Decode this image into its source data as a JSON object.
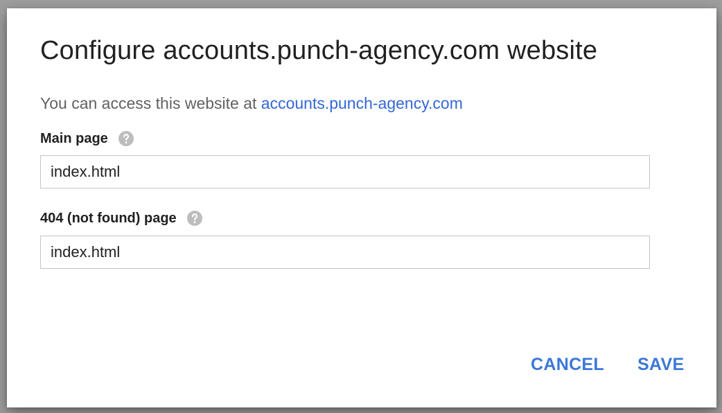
{
  "dialog": {
    "title": "Configure accounts.punch-agency.com website",
    "access_prefix": "You can access this website at ",
    "access_link": "accounts.punch-agency.com",
    "fields": {
      "main_page": {
        "label": "Main page",
        "value": "index.html",
        "help_icon": "help-icon"
      },
      "not_found_page": {
        "label": "404 (not found) page",
        "value": "index.html",
        "help_icon": "help-icon"
      }
    },
    "buttons": {
      "cancel": "CANCEL",
      "save": "SAVE"
    }
  },
  "colors": {
    "accent": "#3b78d8",
    "link": "#3367d6",
    "title_text": "#212121",
    "secondary_text": "#616161",
    "backdrop": "#9e9e9e",
    "input_border": "#c4c4c4",
    "help_icon": "#bdbdbd"
  }
}
